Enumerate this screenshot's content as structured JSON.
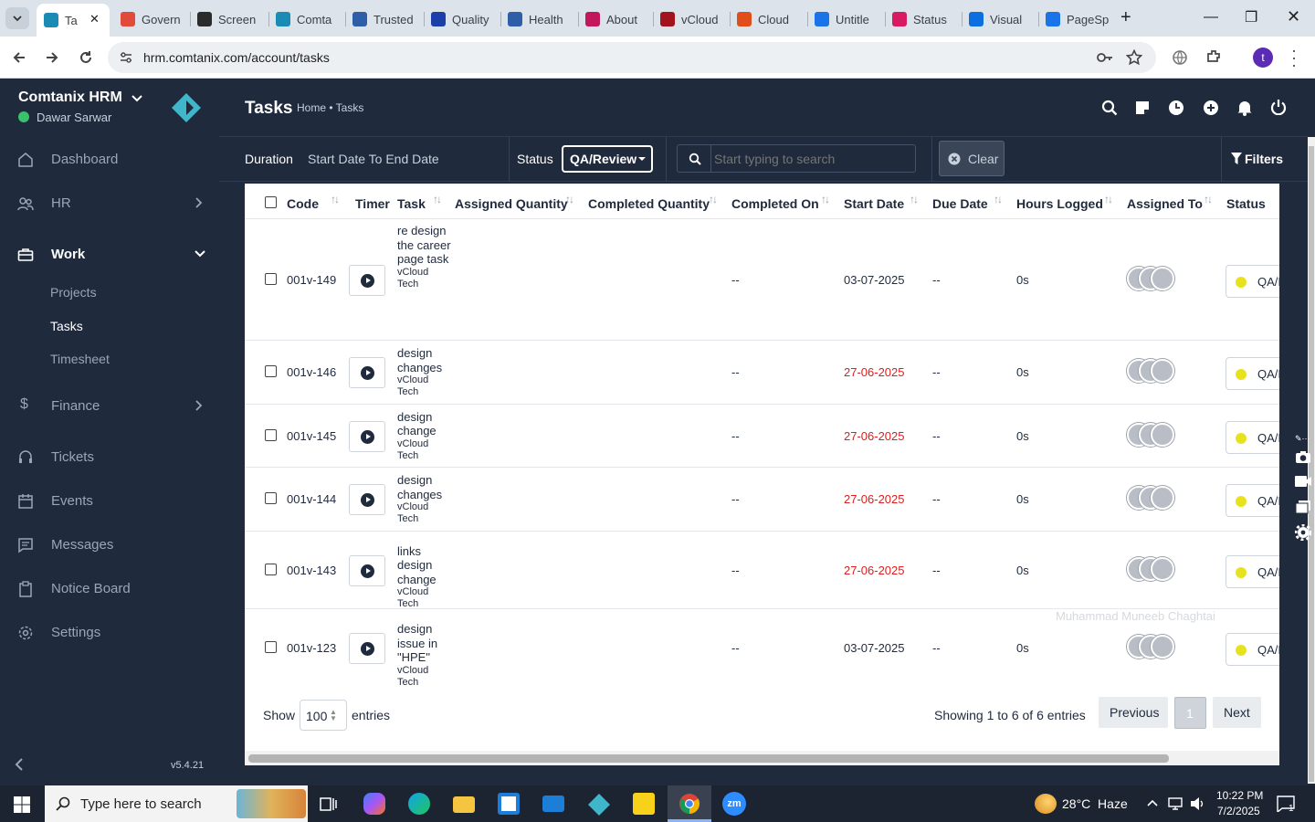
{
  "browser": {
    "tabs": [
      {
        "label": "Ta",
        "color": "#1a8bb5",
        "active": true
      },
      {
        "label": "Govern",
        "color": "#e14b3b"
      },
      {
        "label": "Screen",
        "color": "#2b2b2b"
      },
      {
        "label": "Comta",
        "color": "#1a8bb5"
      },
      {
        "label": "Trusted",
        "color": "#2e5ea8"
      },
      {
        "label": "Quality",
        "color": "#1b3fa8"
      },
      {
        "label": "Health",
        "color": "#2e5ea8"
      },
      {
        "label": "About",
        "color": "#c2185b"
      },
      {
        "label": "vCloud",
        "color": "#a3131d"
      },
      {
        "label": "Cloud",
        "color": "#e04e1b"
      },
      {
        "label": "Untitle",
        "color": "#1a73e8"
      },
      {
        "label": "Status",
        "color": "#d81b60"
      },
      {
        "label": "Visual",
        "color": "#0d6ee0"
      },
      {
        "label": "PageSp",
        "color": "#1a73e8"
      }
    ],
    "url": "hrm.comtanix.com/account/tasks",
    "profile_initial": "t"
  },
  "sidebar": {
    "company": "Comtanix HRM",
    "user": "Dawar Sarwar",
    "online_color": "#39c16c",
    "version": "v5.4.21",
    "items": [
      {
        "label": "Dashboard",
        "icon": "home-icon"
      },
      {
        "label": "HR",
        "icon": "users-icon"
      },
      {
        "label": "Work",
        "icon": "briefcase-icon"
      },
      {
        "label": "Finance",
        "icon": "dollar-icon"
      },
      {
        "label": "Tickets",
        "icon": "headset-icon"
      },
      {
        "label": "Events",
        "icon": "calendar-icon"
      },
      {
        "label": "Messages",
        "icon": "message-icon"
      },
      {
        "label": "Notice Board",
        "icon": "clipboard-icon"
      },
      {
        "label": "Settings",
        "icon": "settings-icon"
      }
    ],
    "work_sub": [
      "Projects",
      "Tasks",
      "Timesheet"
    ]
  },
  "header": {
    "title": "Tasks",
    "breadcrumb": "Home • Tasks"
  },
  "filters": {
    "duration_label": "Duration",
    "duration_value": "Start Date To End Date",
    "status_label": "Status",
    "status_value": "QA/Review",
    "search_placeholder": "Start typing to search",
    "clear_label": "Clear",
    "filters_label": "Filters"
  },
  "table": {
    "columns": [
      "Code",
      "Timer",
      "Task",
      "Assigned Quantity",
      "Completed Quantity",
      "Completed On",
      "Start Date",
      "Due Date",
      "Hours Logged",
      "Assigned To",
      "Status"
    ],
    "rows": [
      {
        "code": "001v-149",
        "task": "re design the career page task",
        "project": "vCloud Tech",
        "completed_on": "--",
        "start_date": "03-07-2025",
        "start_overdue": false,
        "due_date": "--",
        "hours": "0s",
        "status": "QA/I"
      },
      {
        "code": "001v-146",
        "task": "design changes",
        "project": "vCloud Tech",
        "completed_on": "--",
        "start_date": "27-06-2025",
        "start_overdue": true,
        "due_date": "--",
        "hours": "0s",
        "status": "QA/I"
      },
      {
        "code": "001v-145",
        "task": "design change",
        "project": "vCloud Tech",
        "completed_on": "--",
        "start_date": "27-06-2025",
        "start_overdue": true,
        "due_date": "--",
        "hours": "0s",
        "status": "QA/I"
      },
      {
        "code": "001v-144",
        "task": "design changes",
        "project": "vCloud Tech",
        "completed_on": "--",
        "start_date": "27-06-2025",
        "start_overdue": true,
        "due_date": "--",
        "hours": "0s",
        "status": "QA/I"
      },
      {
        "code": "001v-143",
        "task": "links design change",
        "project": "vCloud Tech",
        "completed_on": "--",
        "start_date": "27-06-2025",
        "start_overdue": true,
        "due_date": "--",
        "hours": "0s",
        "status": "QA/I"
      },
      {
        "code": "001v-123",
        "task": "design issue in \"HPE\"",
        "project": "vCloud Tech",
        "completed_on": "--",
        "start_date": "03-07-2025",
        "start_overdue": false,
        "due_date": "--",
        "hours": "0s",
        "status": "QA/I"
      }
    ],
    "tooltip": "Muhammad Muneeb Chaghtai"
  },
  "footer": {
    "show_label": "Show",
    "page_size": "100",
    "entries_label": "entries",
    "info": "Showing 1 to 6 of 6 entries",
    "prev_label": "Previous",
    "current_page": "1",
    "next_label": "Next"
  },
  "taskbar": {
    "search_placeholder": "Type here to search",
    "weather": "28°C  Haze",
    "time": "10:22 PM",
    "date": "7/2/2025",
    "notification_count": "1"
  },
  "colors": {
    "sidebar_bg": "#1f2a3d",
    "status_dot": "#e8e21e",
    "overdue": "#e01c1c",
    "accent": "#3fb6c9"
  }
}
